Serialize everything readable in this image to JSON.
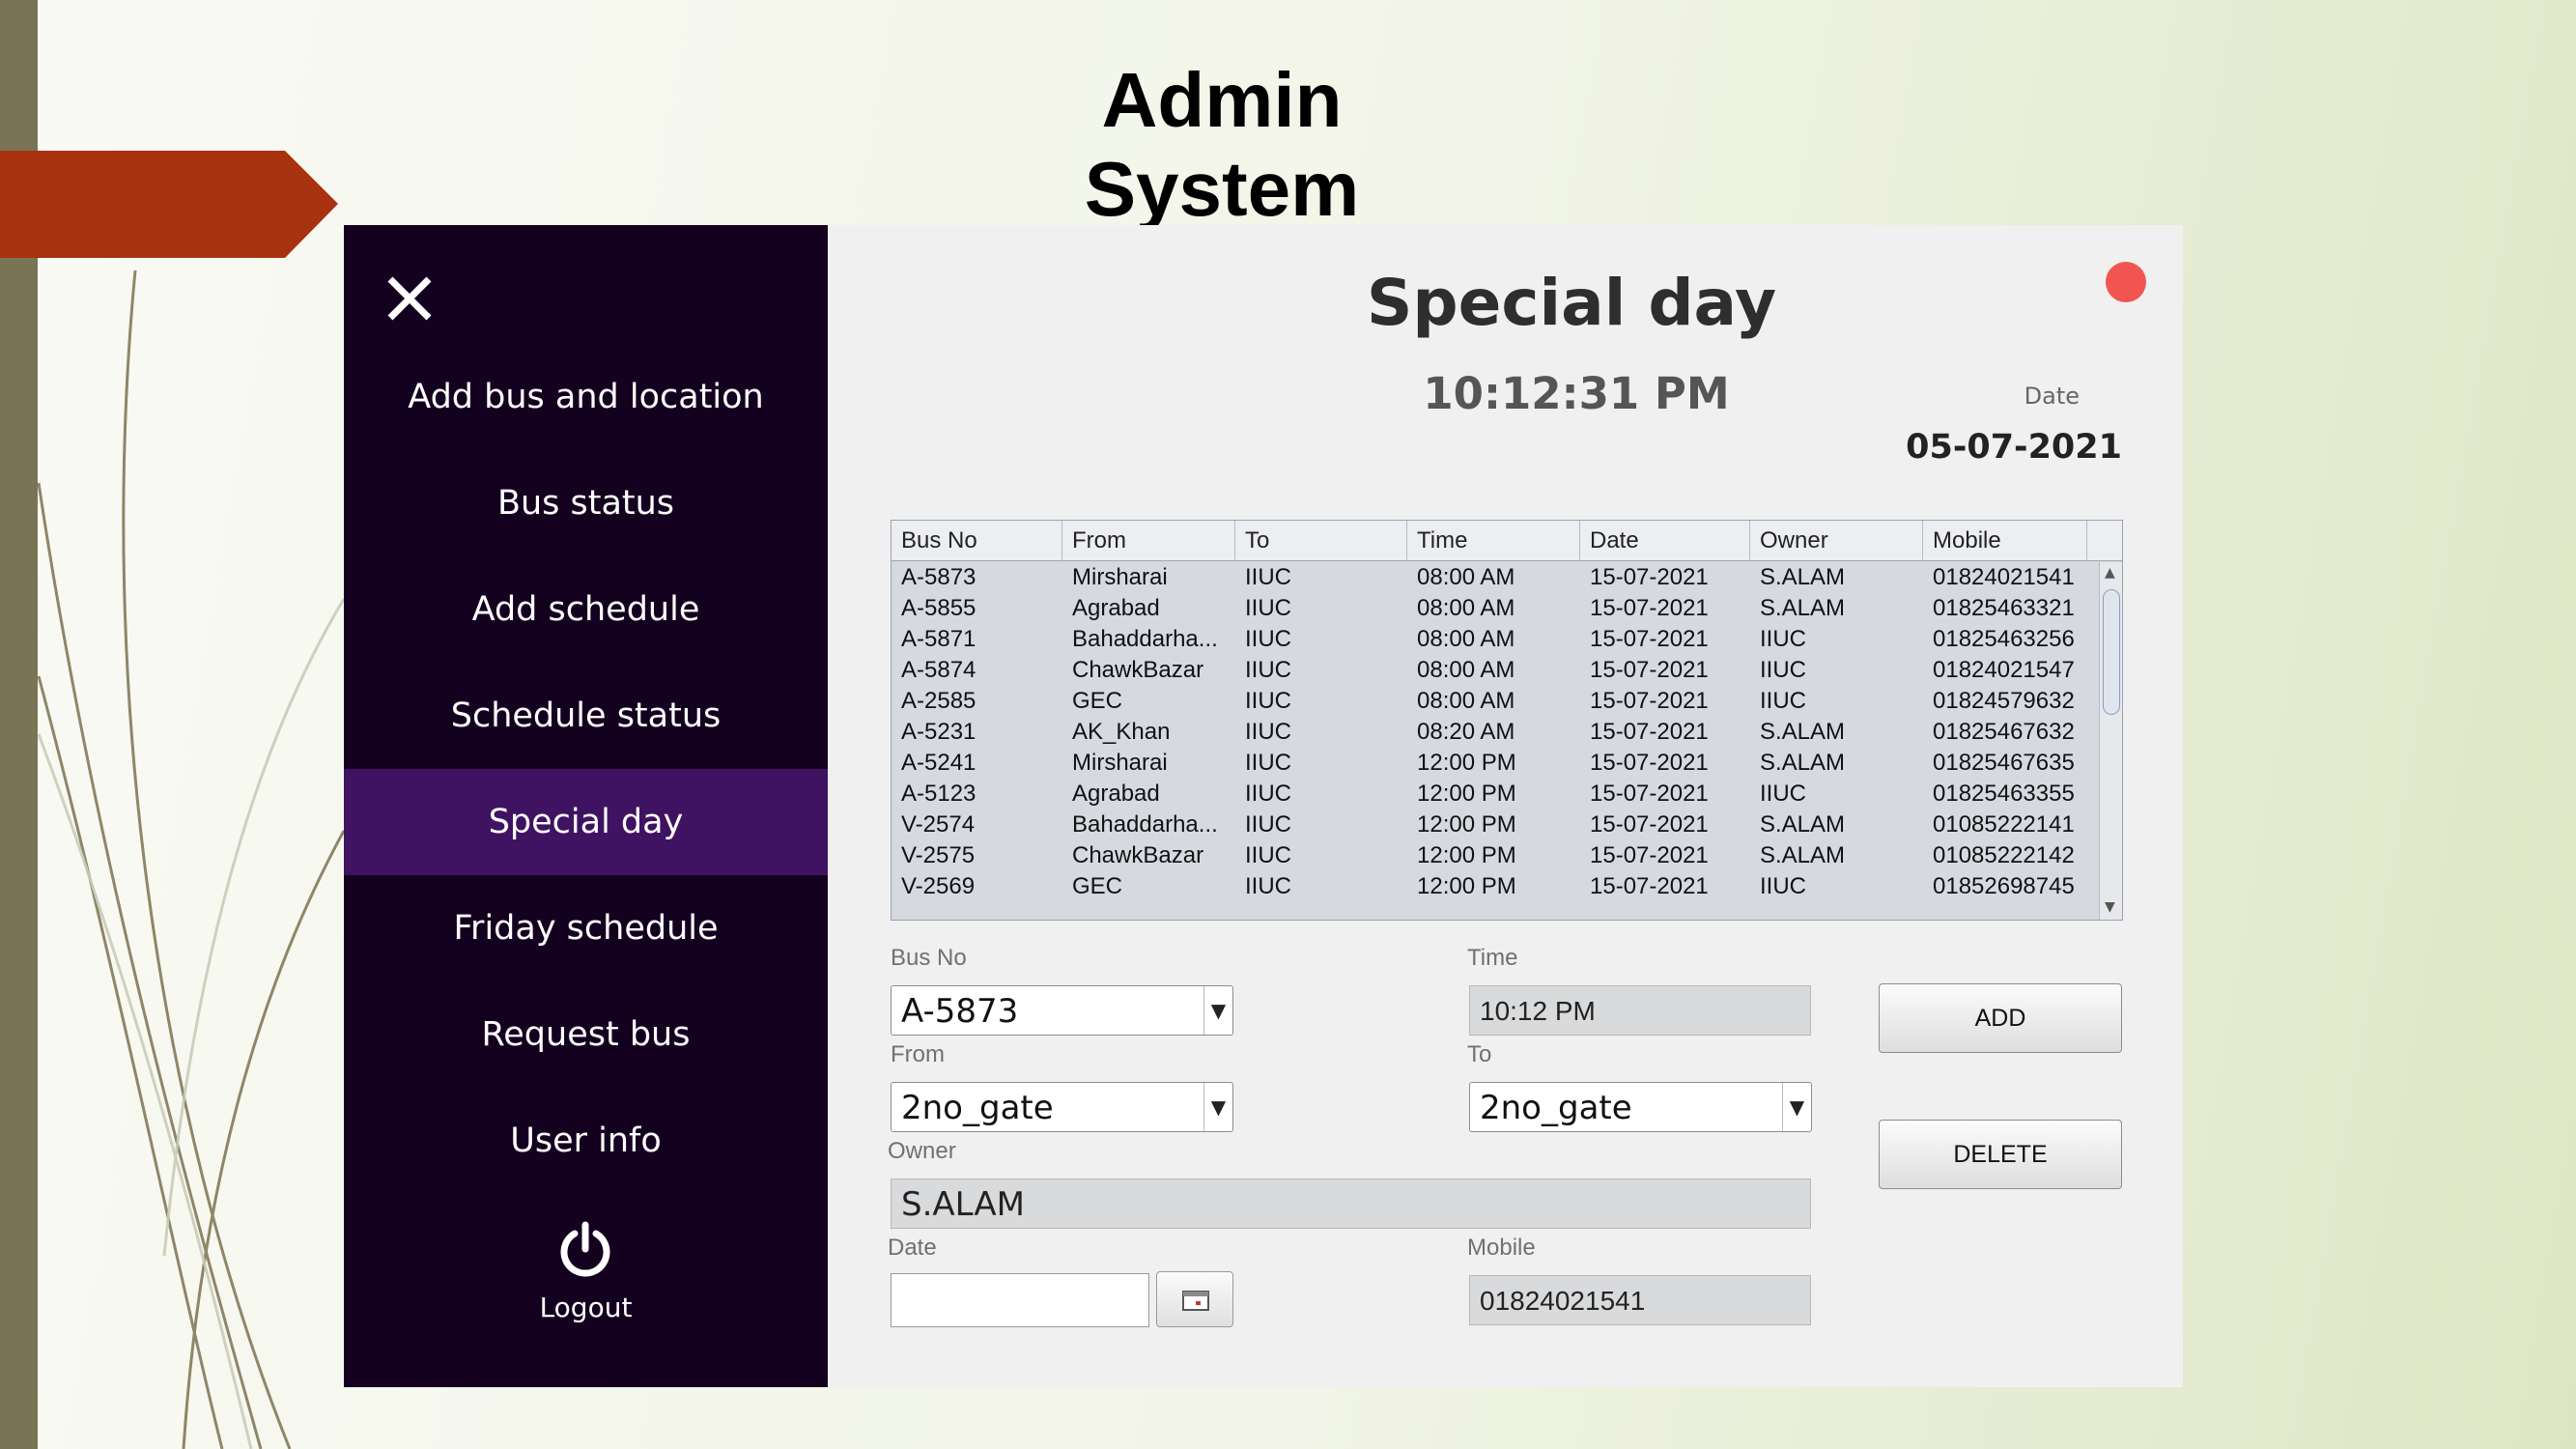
{
  "slide": {
    "title": "Admin System"
  },
  "sidebar": {
    "items": [
      {
        "label": "Add bus and location",
        "active": false
      },
      {
        "label": "Bus status",
        "active": false
      },
      {
        "label": "Add schedule",
        "active": false
      },
      {
        "label": "Schedule status",
        "active": false
      },
      {
        "label": "Special day",
        "active": true
      },
      {
        "label": "Friday schedule",
        "active": false
      },
      {
        "label": "Request bus",
        "active": false
      },
      {
        "label": "User info",
        "active": false
      }
    ],
    "logout_label": "Logout"
  },
  "main": {
    "title": "Special day",
    "clock": "10:12:31 PM",
    "date_caption": "Date",
    "date_value": "05-07-2021"
  },
  "table": {
    "columns": [
      "Bus No",
      "From",
      "To",
      "Time",
      "Date",
      "Owner",
      "Mobile"
    ],
    "rows": [
      [
        "A-5873",
        "Mirsharai",
        "IIUC",
        "08:00 AM",
        "15-07-2021",
        "S.ALAM",
        "01824021541"
      ],
      [
        "A-5855",
        "Agrabad",
        "IIUC",
        "08:00 AM",
        "15-07-2021",
        "S.ALAM",
        "01825463321"
      ],
      [
        "A-5871",
        "Bahaddarha...",
        "IIUC",
        "08:00 AM",
        "15-07-2021",
        "IIUC",
        "01825463256"
      ],
      [
        "A-5874",
        "ChawkBazar",
        "IIUC",
        "08:00 AM",
        "15-07-2021",
        "IIUC",
        "01824021547"
      ],
      [
        "A-2585",
        "GEC",
        "IIUC",
        "08:00 AM",
        "15-07-2021",
        "IIUC",
        "01824579632"
      ],
      [
        "A-5231",
        "AK_Khan",
        "IIUC",
        "08:20 AM",
        "15-07-2021",
        "S.ALAM",
        "01825467632"
      ],
      [
        "A-5241",
        "Mirsharai",
        "IIUC",
        "12:00 PM",
        "15-07-2021",
        "S.ALAM",
        "01825467635"
      ],
      [
        "A-5123",
        "Agrabad",
        "IIUC",
        "12:00 PM",
        "15-07-2021",
        "IIUC",
        "01825463355"
      ],
      [
        "V-2574",
        "Bahaddarha...",
        "IIUC",
        "12:00 PM",
        "15-07-2021",
        "S.ALAM",
        "01085222141"
      ],
      [
        "V-2575",
        "ChawkBazar",
        "IIUC",
        "12:00 PM",
        "15-07-2021",
        "S.ALAM",
        "01085222142"
      ],
      [
        "V-2569",
        "GEC",
        "IIUC",
        "12:00 PM",
        "15-07-2021",
        "IIUC",
        "01852698745"
      ]
    ]
  },
  "form": {
    "bus_no_label": "Bus No",
    "bus_no_value": "A-5873",
    "time_label": "Time",
    "time_value": "10:12 PM",
    "from_label": "From",
    "from_value": "2no_gate",
    "to_label": "To",
    "to_value": "2no_gate",
    "owner_label": "Owner",
    "owner_value": "S.ALAM",
    "date_label": "Date",
    "date_value": "",
    "mobile_label": "Mobile",
    "mobile_value": "01824021541",
    "add_label": "ADD",
    "delete_label": "DELETE"
  },
  "icons": {
    "close": "close-icon",
    "logout": "power-icon",
    "calendar": "calendar-icon",
    "dropdown": "chevron-down-icon",
    "status_dot": "red-status-dot"
  },
  "colors": {
    "sidebar_bg": "#14001f",
    "sidebar_active": "#3f1361",
    "arrow_tag": "#a83210",
    "status_dot": "#f05552",
    "panel_bg": "#f0f0f0"
  }
}
